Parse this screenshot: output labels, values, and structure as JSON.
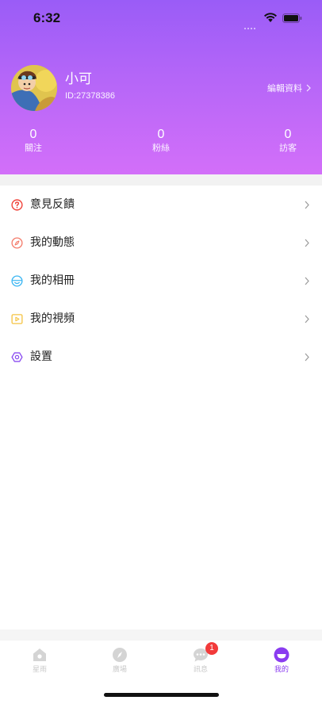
{
  "status_bar": {
    "time": "6:32"
  },
  "profile": {
    "name": "小可",
    "user_id": "ID:27378386",
    "edit_label": "編輯資料"
  },
  "stats": [
    {
      "value": "0",
      "label": "關注"
    },
    {
      "value": "0",
      "label": "粉絲"
    },
    {
      "value": "0",
      "label": "訪客"
    }
  ],
  "menu": {
    "items": [
      {
        "label": "意見反饋",
        "icon": "question-icon",
        "color": "#f0433a"
      },
      {
        "label": "我的動態",
        "icon": "compass-icon",
        "color": "#f47b6a"
      },
      {
        "label": "我的相冊",
        "icon": "smile-icon",
        "color": "#3bb6f2"
      },
      {
        "label": "我的視頻",
        "icon": "play-icon",
        "color": "#f5c342"
      },
      {
        "label": "設置",
        "icon": "settings-icon",
        "color": "#8a4cf0"
      }
    ]
  },
  "tabbar": {
    "tabs": [
      {
        "label": "星雨",
        "icon": "home-icon",
        "active": false
      },
      {
        "label": "廣場",
        "icon": "compass-icon",
        "active": false
      },
      {
        "label": "訊息",
        "icon": "chat-icon",
        "active": false,
        "badge": "1"
      },
      {
        "label": "我的",
        "icon": "profile-icon",
        "active": true
      }
    ]
  },
  "colors": {
    "accent": "#8a3cf0",
    "header_top": "#9a5cf7",
    "header_bottom": "#d36ff9",
    "badge": "#f23a3a"
  }
}
